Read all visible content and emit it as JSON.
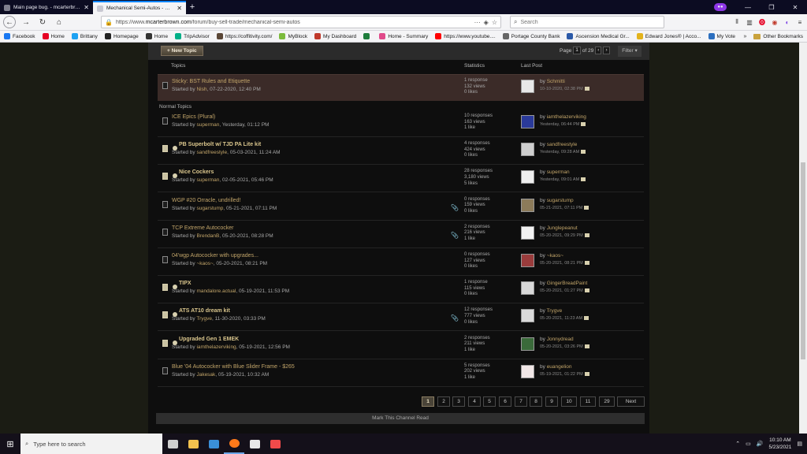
{
  "browser": {
    "tabs": [
      {
        "label": "Main page bug. - mcarterbrown.com",
        "active": false
      },
      {
        "label": "Mechanical Semi-Autos - mcarterbrown.com",
        "active": true
      }
    ],
    "url_prefix": "https://www.",
    "url_domain": "mcarterbrown.com",
    "url_path": "/forum/buy-sell-trade/mechanical-semi-autos",
    "search_placeholder": "Search",
    "url_more": "···",
    "bookmarks": [
      {
        "label": "Facebook",
        "color": "#1877f2"
      },
      {
        "label": "Home",
        "color": "#e60023"
      },
      {
        "label": "Brittany",
        "color": "#1da1f2"
      },
      {
        "label": "Homepage",
        "color": "#222222"
      },
      {
        "label": "Home",
        "color": "#333333"
      },
      {
        "label": "TripAdvisor",
        "color": "#00af87"
      },
      {
        "label": "https://coffitivity.com/",
        "color": "#5a4636"
      },
      {
        "label": "MyBlock",
        "color": "#7cbb3c"
      },
      {
        "label": "My Dashboard",
        "color": "#c0392b"
      },
      {
        "label": "",
        "color": "#1e7d3c"
      },
      {
        "label": "Home - Summary",
        "color": "#e04a8a"
      },
      {
        "label": "https://www.youtube....",
        "color": "#ff0000"
      },
      {
        "label": "Portage County Bank",
        "color": "#666666"
      },
      {
        "label": "Ascension Medical Gr...",
        "color": "#2b59a8"
      },
      {
        "label": "Edward Jones® | Acco...",
        "color": "#e3b31c"
      },
      {
        "label": "My Vote",
        "color": "#2c6fbf"
      }
    ],
    "bookmarks_more": "»",
    "other_bookmarks": "Other Bookmarks"
  },
  "forum": {
    "new_topic_label": "+ New Topic",
    "page_label": "Page",
    "page_current": "1",
    "page_of": "of 29",
    "filter_label": "Filter",
    "col_topics": "Topics",
    "col_statistics": "Statistics",
    "col_last_post": "Last Post",
    "section_normal": "Normal Topics",
    "sticky": {
      "title": "Sticky: BST Rules and Etiquette",
      "meta_prefix": "Started by",
      "author": "Nish",
      "date": ", 07-22-2020, 12:40 PM",
      "responses": "1 response",
      "views": "132 views",
      "likes": "0 likes",
      "last_by_label": "by",
      "last_by": "Schmitti",
      "last_time": "10-10-2020, 02:38 PM"
    },
    "topics": [
      {
        "title": "ICE Epics (Plural)",
        "hot": false,
        "clip": false,
        "author": "superman",
        "date": ", Yesterday, 01:12 PM",
        "responses": "10 responses",
        "views": "163 views",
        "likes": "1 like",
        "last_by": "iamthelazerviking",
        "last_time": "Yesterday, 06:44 PM",
        "avatar_color": "#2a3a9a"
      },
      {
        "title": "PB Superbolt w/ TJD PA Lite kit",
        "hot": true,
        "clip": false,
        "author": "sandfreestyle",
        "date": ", 05-03-2021, 11:24 AM",
        "responses": "4 responses",
        "views": "424 views",
        "likes": "0 likes",
        "last_by": "sandfreestyle",
        "last_time": "Yesterday, 09:28 AM",
        "avatar_color": "#cfcfcf"
      },
      {
        "title": "Nice Cockers",
        "hot": true,
        "clip": false,
        "author": "superman",
        "date": ", 02-05-2021, 05:46 PM",
        "responses": "28 responses",
        "views": "3,180 views",
        "likes": "5 likes",
        "last_by": "superman",
        "last_time": "Yesterday, 09:01 AM",
        "avatar_color": "#eeeeee"
      },
      {
        "title": "WGP #20 Orracle, undrilled!",
        "hot": false,
        "clip": true,
        "author": "sugarstump",
        "date": ", 05-21-2021, 07:11 PM",
        "responses": "0 responses",
        "views": "159 views",
        "likes": "0 likes",
        "last_by": "sugarstump",
        "last_time": "05-21-2021, 07:11 PM",
        "avatar_color": "#8c7b5a"
      },
      {
        "title": "TCP Extreme Autococker",
        "hot": false,
        "clip": true,
        "author": "BrendanB",
        "date": ", 05-20-2021, 08:28 PM",
        "responses": "2 responses",
        "views": "216 views",
        "likes": "1 like",
        "last_by": "Junglepeanut",
        "last_time": "05-20-2021, 09:29 PM",
        "avatar_color": "#f2f2f2"
      },
      {
        "title": "04'wgp Autococker with upgrades...",
        "hot": false,
        "clip": false,
        "author": "~kaos~",
        "date": ", 05-20-2021, 08:21 PM",
        "responses": "0 responses",
        "views": "127 views",
        "likes": "0 likes",
        "last_by": "~kaos~",
        "last_time": "05-20-2021, 08:21 PM",
        "avatar_color": "#9a3c3c"
      },
      {
        "title": "TIPX",
        "hot": true,
        "clip": false,
        "author": "mandalore.actual",
        "date": ", 05-19-2021, 11:53 PM",
        "responses": "1 response",
        "views": "115 views",
        "likes": "0 likes",
        "last_by": "GingerBreadPaint",
        "last_time": "05-20-2021, 01:27 PM",
        "avatar_color": "#d8d8d8"
      },
      {
        "title": "ATS AT10 dream kit",
        "hot": true,
        "clip": true,
        "author": "Trygve",
        "date": ", 11-30-2020, 03:33 PM",
        "responses": "12 responses",
        "views": "777 views",
        "likes": "0 likes",
        "last_by": "Trygve",
        "last_time": "05-20-2021, 11:23 AM",
        "avatar_color": "#dadada"
      },
      {
        "title": "Upgraded Gen 1 EMEK",
        "hot": true,
        "clip": false,
        "author": "iamthelazerviking",
        "date": ", 05-19-2021, 12:56 PM",
        "responses": "2 responses",
        "views": "211 views",
        "likes": "1 like",
        "last_by": "Jonnydread",
        "last_time": "05-20-2021, 03:26 PM",
        "avatar_color": "#3a6a3a"
      },
      {
        "title": "Blue '04 Autococker with Blue Slider Frame - $265",
        "hot": false,
        "clip": false,
        "author": "Jakesak",
        "date": ", 05-19-2021, 10:32 AM",
        "responses": "5 responses",
        "views": "202 views",
        "likes": "1 like",
        "last_by": "euangelion",
        "last_time": "05-19-2021, 01:22 PM",
        "avatar_color": "#f0e6e6"
      }
    ],
    "pages": [
      "1",
      "2",
      "3",
      "4",
      "5",
      "6",
      "7",
      "8",
      "9",
      "10",
      "11",
      "29",
      "Next"
    ],
    "mark_read": "Mark This Channel Read"
  },
  "taskbar": {
    "search_placeholder": "Type here to search",
    "time": "10:10 AM",
    "date": "5/23/2021",
    "apps": [
      {
        "name": "task-view",
        "color": "#cfcfcf"
      },
      {
        "name": "file-explorer",
        "color": "#f2c14e"
      },
      {
        "name": "mail",
        "color": "#3a8fd8"
      },
      {
        "name": "firefox",
        "color": "#ff7a1a"
      },
      {
        "name": "store",
        "color": "#e8e8e8"
      },
      {
        "name": "paint",
        "color": "#f04a4a"
      }
    ]
  },
  "colors": {
    "accent_link": "#c2a56a",
    "sticky_bg": "#3b2b28",
    "forum_bg": "#0e0e0e",
    "page_bg": "#1b1c14"
  }
}
